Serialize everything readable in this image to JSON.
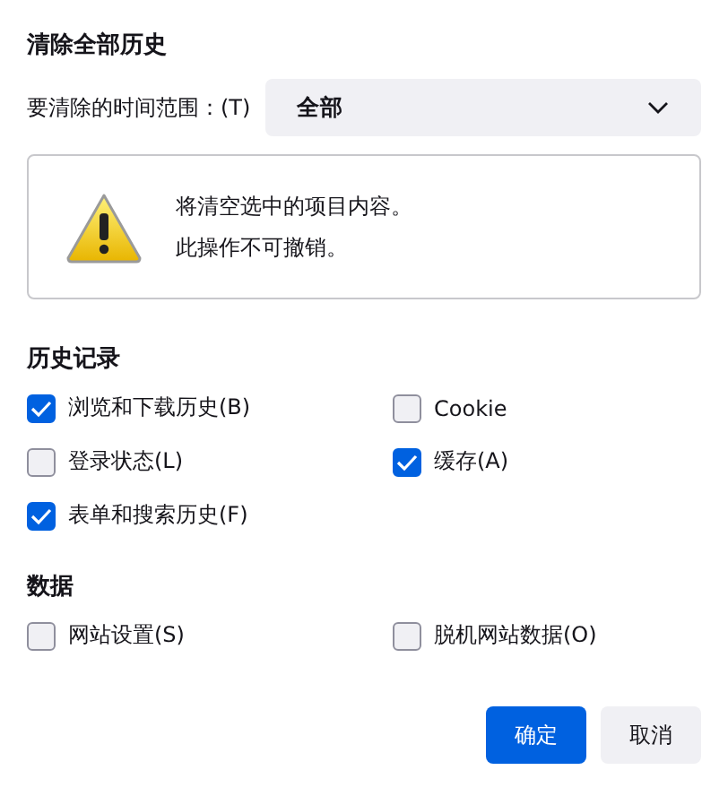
{
  "dialog": {
    "title": "清除全部历史"
  },
  "time_range": {
    "label": "要清除的时间范围：(T)",
    "value": "全部"
  },
  "warning": {
    "lines": [
      "将清空选中的项目内容。",
      "此操作不可撤销。"
    ]
  },
  "sections": [
    {
      "heading": "历史记录",
      "items": [
        {
          "label": "浏览和下载历史(B)",
          "checked": true
        },
        {
          "label": "Cookie",
          "checked": false
        },
        {
          "label": "登录状态(L)",
          "checked": false
        },
        {
          "label": "缓存(A)",
          "checked": true
        },
        {
          "label": "表单和搜索历史(F)",
          "checked": true
        }
      ]
    },
    {
      "heading": "数据",
      "items": [
        {
          "label": "网站设置(S)",
          "checked": false
        },
        {
          "label": "脱机网站数据(O)",
          "checked": false
        }
      ]
    }
  ],
  "buttons": [
    {
      "label": "确定",
      "kind": "primary"
    },
    {
      "label": "取消",
      "kind": "secondary"
    }
  ]
}
